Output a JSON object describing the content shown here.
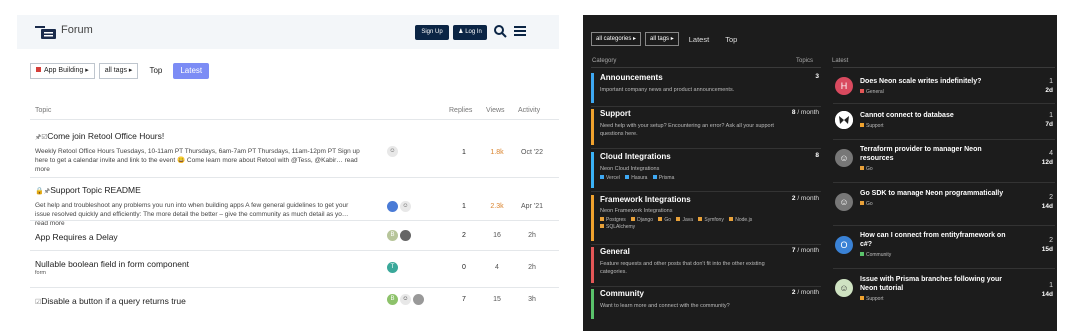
{
  "left": {
    "header": {
      "title": "Forum",
      "signup": "Sign Up",
      "login": "Log In"
    },
    "filters": {
      "category": "App Building",
      "tags": "all tags",
      "tabs": [
        "Top",
        "Latest"
      ],
      "active_tab": "Latest"
    },
    "columns": {
      "topic": "Topic",
      "replies": "Replies",
      "views": "Views",
      "activity": "Activity"
    },
    "topics": [
      {
        "title": "Come join Retool Office Hours!",
        "excerpt": "Weekly Retool Office Hours Tuesdays, 10-11am PT Thursdays, 6am-7am PT Thursdays, 11am-12pm PT Sign up here to get a calendar invite and link to the event 😀 Come learn more about Retool with @Tess, @Kabir… read more",
        "replies": "1",
        "views": "1.8k",
        "activity": "Oct '22"
      },
      {
        "title": "Support Topic README",
        "excerpt": "Get help and troubleshoot any problems you run into when building apps A few general guidelines to get your issue resolved quickly and efficiently: The more detail the better – give the community as much detail as yo… read more",
        "replies": "1",
        "views": "2.3k",
        "activity": "Apr '21"
      },
      {
        "title": "App Requires a Delay",
        "replies": "2",
        "views": "16",
        "activity": "2h"
      },
      {
        "title": "Nullable boolean field in form component",
        "sub": "form",
        "replies": "0",
        "views": "4",
        "activity": "2h"
      },
      {
        "title": "Disable a button if a query returns true",
        "replies": "7",
        "views": "15",
        "activity": "3h"
      }
    ],
    "avatars": [
      "B",
      "T",
      "B"
    ],
    "colors": {
      "accent": "#7c8cf5",
      "header_btn": "#0b2545",
      "views_hot": "#d9822b"
    }
  },
  "right": {
    "filters": {
      "category": "all categories",
      "tags": "all tags",
      "tabs": [
        "Latest",
        "Top"
      ]
    },
    "columns": {
      "category": "Category",
      "topics": "Topics",
      "latest": "Latest"
    },
    "categories": [
      {
        "name": "Announcements",
        "desc": "Important company news and product announcements.",
        "count": "3",
        "per": "",
        "color": "#3ea8f2"
      },
      {
        "name": "Support",
        "desc": "Need help with your setup? Encountering an error? Ask all your support questions here.",
        "count": "8",
        "per": "/ month",
        "color": "#f0a22e"
      },
      {
        "name": "Cloud Integrations",
        "desc": "Neon Cloud Integrations",
        "count": "8",
        "per": "",
        "color": "#3bb3f7",
        "subs": [
          {
            "name": "Vercel",
            "color": "#3ea8f2"
          },
          {
            "name": "Hasura",
            "color": "#3ea8f2"
          },
          {
            "name": "Prisma",
            "color": "#3ea8f2"
          }
        ]
      },
      {
        "name": "Framework Integrations",
        "desc": "Neon Framework Integrations",
        "count": "2",
        "per": "/ month",
        "color": "#f0a22e",
        "subs": [
          {
            "name": "Postgres",
            "color": "#e8a13a"
          },
          {
            "name": "Django",
            "color": "#e8a13a"
          },
          {
            "name": "Go",
            "color": "#e8a13a"
          },
          {
            "name": "Java",
            "color": "#e8a13a"
          },
          {
            "name": "Symfony",
            "color": "#e8a13a"
          },
          {
            "name": "Node.js",
            "color": "#e8a13a"
          },
          {
            "name": "SQLAlchemy",
            "color": "#e8a13a"
          }
        ]
      },
      {
        "name": "General",
        "desc": "Feature requests and other posts that don't fit into the other existing categories.",
        "count": "7",
        "per": "/ month",
        "color": "#e45757"
      },
      {
        "name": "Community",
        "desc": "Want to learn more and connect with the community?",
        "count": "2",
        "per": "/ month",
        "color": "#5ac26b"
      }
    ],
    "latest": [
      {
        "title": "Does Neon scale writes indefinitely?",
        "cat": "General",
        "cat_color": "#e45757",
        "replies": "1",
        "age": "2d",
        "avatar": "H",
        "avatar_color": "#d94a5f"
      },
      {
        "title": "Cannot connect to database",
        "cat": "Support",
        "cat_color": "#f0a22e",
        "replies": "1",
        "age": "7d",
        "avatar": "",
        "avatar_color": "#ffffff"
      },
      {
        "title": "Terraform provider to manager Neon resources",
        "cat": "Go",
        "cat_color": "#e8a13a",
        "replies": "4",
        "age": "12d",
        "avatar": "",
        "avatar_color": "#888888"
      },
      {
        "title": "Go SDK to manage Neon programmatically",
        "cat": "Go",
        "cat_color": "#e8a13a",
        "replies": "2",
        "age": "14d",
        "avatar": "",
        "avatar_color": "#888888"
      },
      {
        "title": "How can I connect from entityframework on c#?",
        "cat": "Community",
        "cat_color": "#5ac26b",
        "replies": "2",
        "age": "15d",
        "avatar": "O",
        "avatar_color": "#3a82d6"
      },
      {
        "title": "Issue with Prisma branches following your Neon tutorial",
        "cat": "Support",
        "cat_color": "#f0a22e",
        "replies": "1",
        "age": "14d",
        "avatar": "",
        "avatar_color": "#cfe3c2"
      }
    ]
  }
}
